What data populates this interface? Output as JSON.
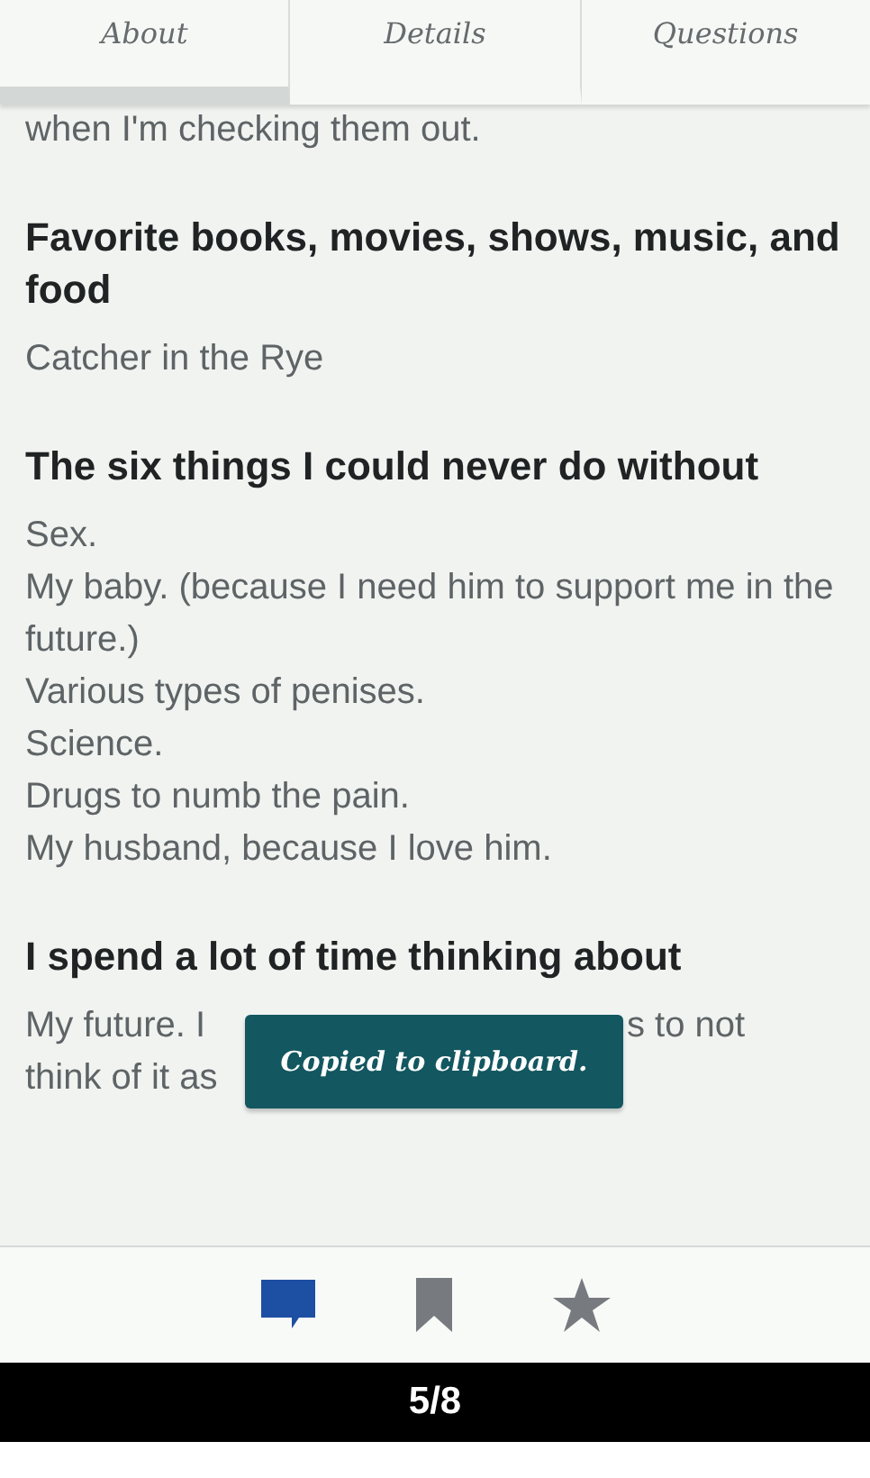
{
  "tabs": [
    {
      "label": "About",
      "selected": true
    },
    {
      "label": "Details",
      "selected": false
    },
    {
      "label": "Questions",
      "selected": false
    }
  ],
  "content": {
    "cut_line": "when I'm checking them out.",
    "sections": [
      {
        "heading": "Favorite books, movies, shows, music, and food",
        "lines": [
          "Catcher in the Rye"
        ]
      },
      {
        "heading": "The six things I could never do without",
        "lines": [
          "Sex.",
          "My baby. (because I need him to support me in the future.)",
          "Various types of penises.",
          "Science.",
          "Drugs to numb the pain.",
          "My husband, because I love him."
        ]
      },
      {
        "heading": "I spend a lot of time thinking about",
        "covered_lines": [
          [
            "My future. I",
            "s to not"
          ],
          [
            "think of it as"
          ]
        ]
      }
    ]
  },
  "toast": "Copied to clipboard.",
  "actions": [
    {
      "kind": "comment",
      "selected": true
    },
    {
      "kind": "bookmark",
      "selected": false
    },
    {
      "kind": "star",
      "selected": false
    }
  ],
  "page_counter": "5/8"
}
